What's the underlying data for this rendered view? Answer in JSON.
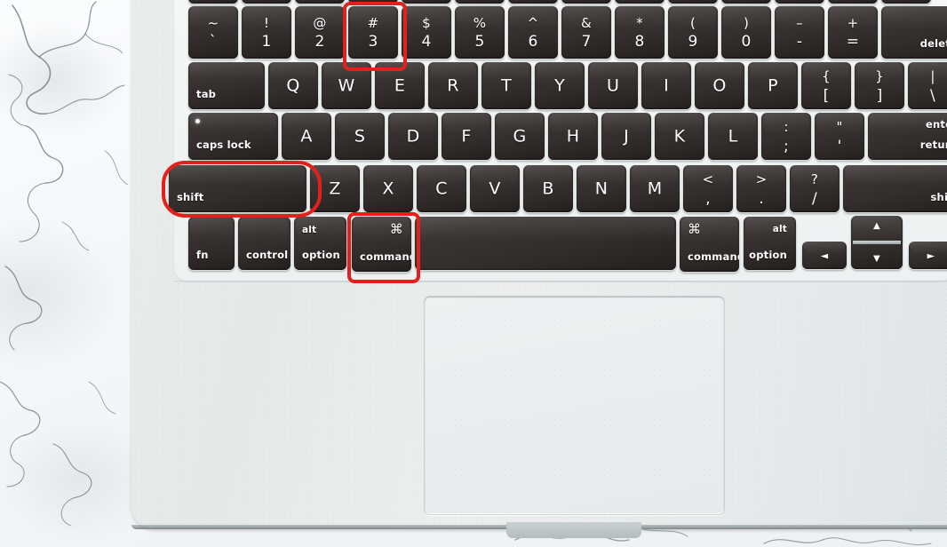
{
  "scene": {
    "description": "MacBook keyboard photo with red annotation boxes highlighting the Shift, Command and 3 keys",
    "background": "white marble surface",
    "device": "MacBook laptop",
    "accent_color": "#e3211c",
    "key_color": "#332e2d",
    "body_color": "#e6eaea"
  },
  "annotations": [
    {
      "target": "key-3",
      "label": "3"
    },
    {
      "target": "key-shift-left",
      "label": "shift"
    },
    {
      "target": "key-command-left",
      "label": "command"
    }
  ],
  "keyboard": {
    "rows": [
      {
        "name": "function-row",
        "keys": [
          {
            "name": "fkey",
            "top": "",
            "bottom": ""
          },
          {
            "name": "fkey",
            "top": "",
            "bottom": ""
          },
          {
            "name": "fkey",
            "top": "",
            "bottom": ""
          },
          {
            "name": "fkey",
            "top": "",
            "bottom": ""
          },
          {
            "name": "fkey",
            "top": "",
            "bottom": ""
          },
          {
            "name": "fkey",
            "top": "",
            "bottom": ""
          },
          {
            "name": "fkey",
            "top": "",
            "bottom": ""
          },
          {
            "name": "fkey",
            "top": "",
            "bottom": ""
          },
          {
            "name": "fkey",
            "top": "",
            "bottom": ""
          },
          {
            "name": "fkey",
            "top": "",
            "bottom": ""
          },
          {
            "name": "fkey",
            "top": "",
            "bottom": ""
          },
          {
            "name": "fkey",
            "top": "",
            "bottom": ""
          },
          {
            "name": "fkey",
            "top": "",
            "bottom": ""
          },
          {
            "name": "fkey",
            "top": "",
            "bottom": ""
          }
        ]
      },
      {
        "name": "number-row",
        "keys": [
          {
            "name": "key-tilde",
            "top": "~",
            "bottom": "`"
          },
          {
            "name": "key-1",
            "top": "!",
            "bottom": "1"
          },
          {
            "name": "key-2",
            "top": "@",
            "bottom": "2"
          },
          {
            "name": "key-3",
            "top": "#",
            "bottom": "3"
          },
          {
            "name": "key-4",
            "top": "$",
            "bottom": "4"
          },
          {
            "name": "key-5",
            "top": "%",
            "bottom": "5"
          },
          {
            "name": "key-6",
            "top": "^",
            "bottom": "6"
          },
          {
            "name": "key-7",
            "top": "&",
            "bottom": "7"
          },
          {
            "name": "key-8",
            "top": "*",
            "bottom": "8"
          },
          {
            "name": "key-9",
            "top": "(",
            "bottom": "9"
          },
          {
            "name": "key-0",
            "top": ")",
            "bottom": "0"
          },
          {
            "name": "key-minus",
            "top": "–",
            "bottom": "-"
          },
          {
            "name": "key-equals",
            "top": "+",
            "bottom": "="
          },
          {
            "name": "key-delete",
            "label": "delete"
          }
        ]
      },
      {
        "name": "top-letter-row",
        "keys": [
          {
            "name": "key-tab",
            "label": "tab"
          },
          {
            "name": "key-q",
            "label": "Q"
          },
          {
            "name": "key-w",
            "label": "W"
          },
          {
            "name": "key-e",
            "label": "E"
          },
          {
            "name": "key-r",
            "label": "R"
          },
          {
            "name": "key-t",
            "label": "T"
          },
          {
            "name": "key-y",
            "label": "Y"
          },
          {
            "name": "key-u",
            "label": "U"
          },
          {
            "name": "key-i",
            "label": "I"
          },
          {
            "name": "key-o",
            "label": "O"
          },
          {
            "name": "key-p",
            "label": "P"
          },
          {
            "name": "key-bracket-left",
            "top": "{",
            "bottom": "["
          },
          {
            "name": "key-bracket-right",
            "top": "}",
            "bottom": "]"
          },
          {
            "name": "key-backslash",
            "top": "|",
            "bottom": "\\"
          }
        ]
      },
      {
        "name": "home-row",
        "keys": [
          {
            "name": "key-caps-lock",
            "label": "caps lock"
          },
          {
            "name": "key-a",
            "label": "A"
          },
          {
            "name": "key-s",
            "label": "S"
          },
          {
            "name": "key-d",
            "label": "D"
          },
          {
            "name": "key-f",
            "label": "F"
          },
          {
            "name": "key-g",
            "label": "G"
          },
          {
            "name": "key-h",
            "label": "H"
          },
          {
            "name": "key-j",
            "label": "J"
          },
          {
            "name": "key-k",
            "label": "K"
          },
          {
            "name": "key-l",
            "label": "L"
          },
          {
            "name": "key-semicolon",
            "top": ":",
            "bottom": ";"
          },
          {
            "name": "key-quote",
            "top": "\"",
            "bottom": "'"
          },
          {
            "name": "key-return",
            "top": "enter",
            "bottom": "return"
          }
        ]
      },
      {
        "name": "bottom-letter-row",
        "keys": [
          {
            "name": "key-shift-left",
            "label": "shift"
          },
          {
            "name": "key-z",
            "label": "Z"
          },
          {
            "name": "key-x",
            "label": "X"
          },
          {
            "name": "key-c",
            "label": "C"
          },
          {
            "name": "key-v",
            "label": "V"
          },
          {
            "name": "key-b",
            "label": "B"
          },
          {
            "name": "key-n",
            "label": "N"
          },
          {
            "name": "key-m",
            "label": "M"
          },
          {
            "name": "key-comma",
            "top": "<",
            "bottom": ","
          },
          {
            "name": "key-period",
            "top": ">",
            "bottom": "."
          },
          {
            "name": "key-slash",
            "top": "?",
            "bottom": "/"
          },
          {
            "name": "key-shift-right",
            "label": "shift"
          }
        ]
      },
      {
        "name": "modifier-row",
        "keys": [
          {
            "name": "key-fn",
            "label": "fn"
          },
          {
            "name": "key-control",
            "label": "control"
          },
          {
            "name": "key-option-left",
            "top": "alt",
            "bottom": "option"
          },
          {
            "name": "key-command-left",
            "top": "⌘",
            "bottom": "command"
          },
          {
            "name": "key-space",
            "label": ""
          },
          {
            "name": "key-command-right",
            "top": "⌘",
            "bottom": "command"
          },
          {
            "name": "key-option-right",
            "top": "alt",
            "bottom": "option"
          },
          {
            "name": "key-arrow-left",
            "label": "◄"
          },
          {
            "name": "key-arrow-up",
            "label": "▲"
          },
          {
            "name": "key-arrow-down",
            "label": "▼"
          },
          {
            "name": "key-arrow-right",
            "label": "►"
          }
        ]
      }
    ]
  }
}
